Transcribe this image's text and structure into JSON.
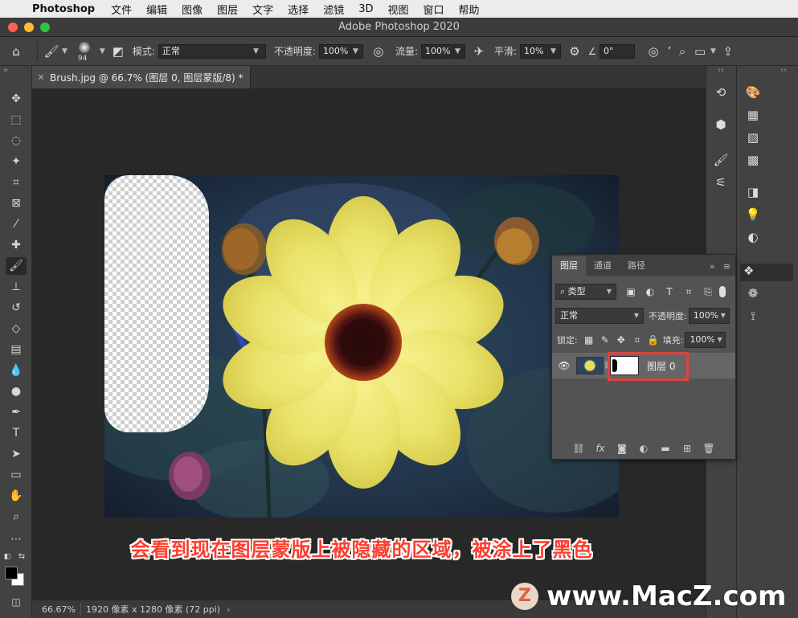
{
  "menubar": {
    "app": "Photoshop",
    "items": [
      "文件",
      "编辑",
      "图像",
      "图层",
      "文字",
      "选择",
      "滤镜",
      "3D",
      "视图",
      "窗口",
      "帮助"
    ]
  },
  "window": {
    "title": "Adobe Photoshop 2020"
  },
  "options": {
    "brush_size": "94",
    "mode_label": "模式:",
    "mode_value": "正常",
    "opacity_label": "不透明度:",
    "opacity_value": "100%",
    "flow_label": "流量:",
    "flow_value": "100%",
    "smooth_label": "平滑:",
    "smooth_value": "10%",
    "angle_value": "0°"
  },
  "document": {
    "tab_title": "Brush.jpg @ 66.7% (图层 0, 图层蒙版/8) *",
    "zoom": "66.67%",
    "info": "1920 像素 x 1280 像素 (72 ppi)"
  },
  "layers_panel": {
    "tabs": [
      "图层",
      "通道",
      "路径"
    ],
    "filter_kind": "类型",
    "blend_mode": "正常",
    "opacity_label": "不透明度:",
    "opacity_value": "100%",
    "lock_label": "锁定:",
    "fill_label": "填充:",
    "fill_value": "100%",
    "layer_name": "图层 0",
    "bottom_icons": [
      "link-icon",
      "fx-icon",
      "mask-icon",
      "adjustment-icon",
      "folder-icon",
      "new-layer-icon",
      "trash-icon"
    ],
    "fx_label": "fx"
  },
  "caption": "会看到现在图层蒙版上被隐藏的区域，被涂上了黑色",
  "watermark": {
    "logo": "Z",
    "text": "www.MacZ.com"
  },
  "colors": {
    "highlight": "#e0423a",
    "caption": "#ff3d2e"
  }
}
